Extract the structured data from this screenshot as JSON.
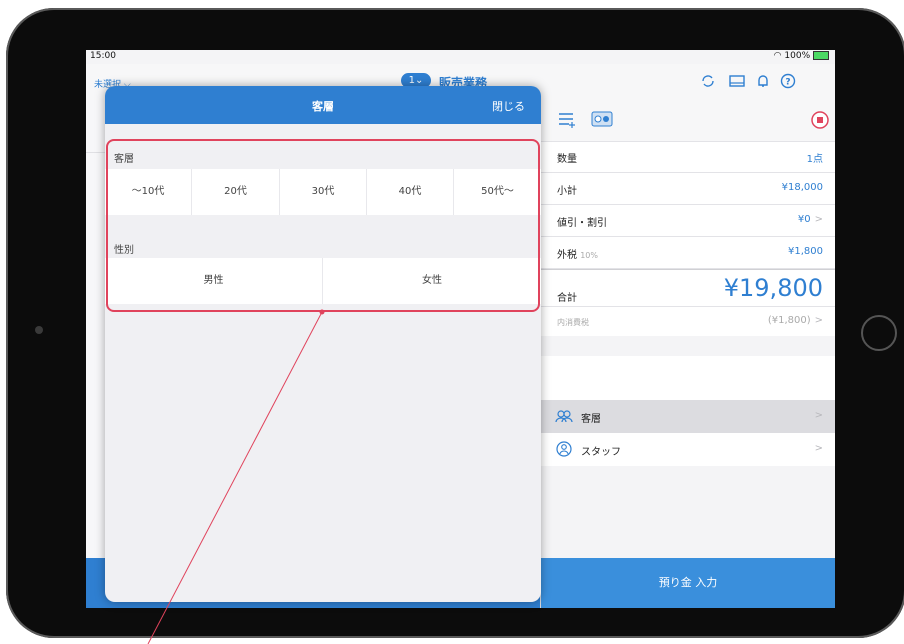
{
  "colors": {
    "accent": "#2f7fd1",
    "highlight": "#e0435c",
    "stop": "#e0435c"
  },
  "status": {
    "time": "15:00",
    "battery": "100%"
  },
  "nav": {
    "left_label": "未選択",
    "badge": "1",
    "title": "販売業務",
    "icons": [
      "refresh-icon",
      "drawer-icon",
      "bell-icon",
      "help-icon"
    ]
  },
  "right": {
    "toolbar_icons": [
      "list-add-icon",
      "scan-icon",
      "stop-icon"
    ],
    "rows": [
      {
        "label": "数量",
        "value": "1点"
      },
      {
        "label": "小計",
        "value": "¥18,000"
      },
      {
        "label": "値引・割引",
        "value": "¥0"
      },
      {
        "label": "外税",
        "sub": "10%",
        "value": "¥1,800"
      }
    ],
    "total_label": "合計",
    "total_value": "¥19,800",
    "inner_tax_label": "内消費税",
    "inner_tax_value": "(¥1,800)",
    "menu": [
      {
        "label": "客層",
        "icon": "group-icon"
      },
      {
        "label": "スタッフ",
        "icon": "staff-icon"
      }
    ]
  },
  "bottom": {
    "deposit_label": "預り金 入力"
  },
  "modal": {
    "title": "客層",
    "close_label": "閉じる",
    "age_section": "客層",
    "ages": [
      "〜10代",
      "20代",
      "30代",
      "40代",
      "50代〜"
    ],
    "gender_section": "性別",
    "genders": [
      "男性",
      "女性"
    ]
  }
}
